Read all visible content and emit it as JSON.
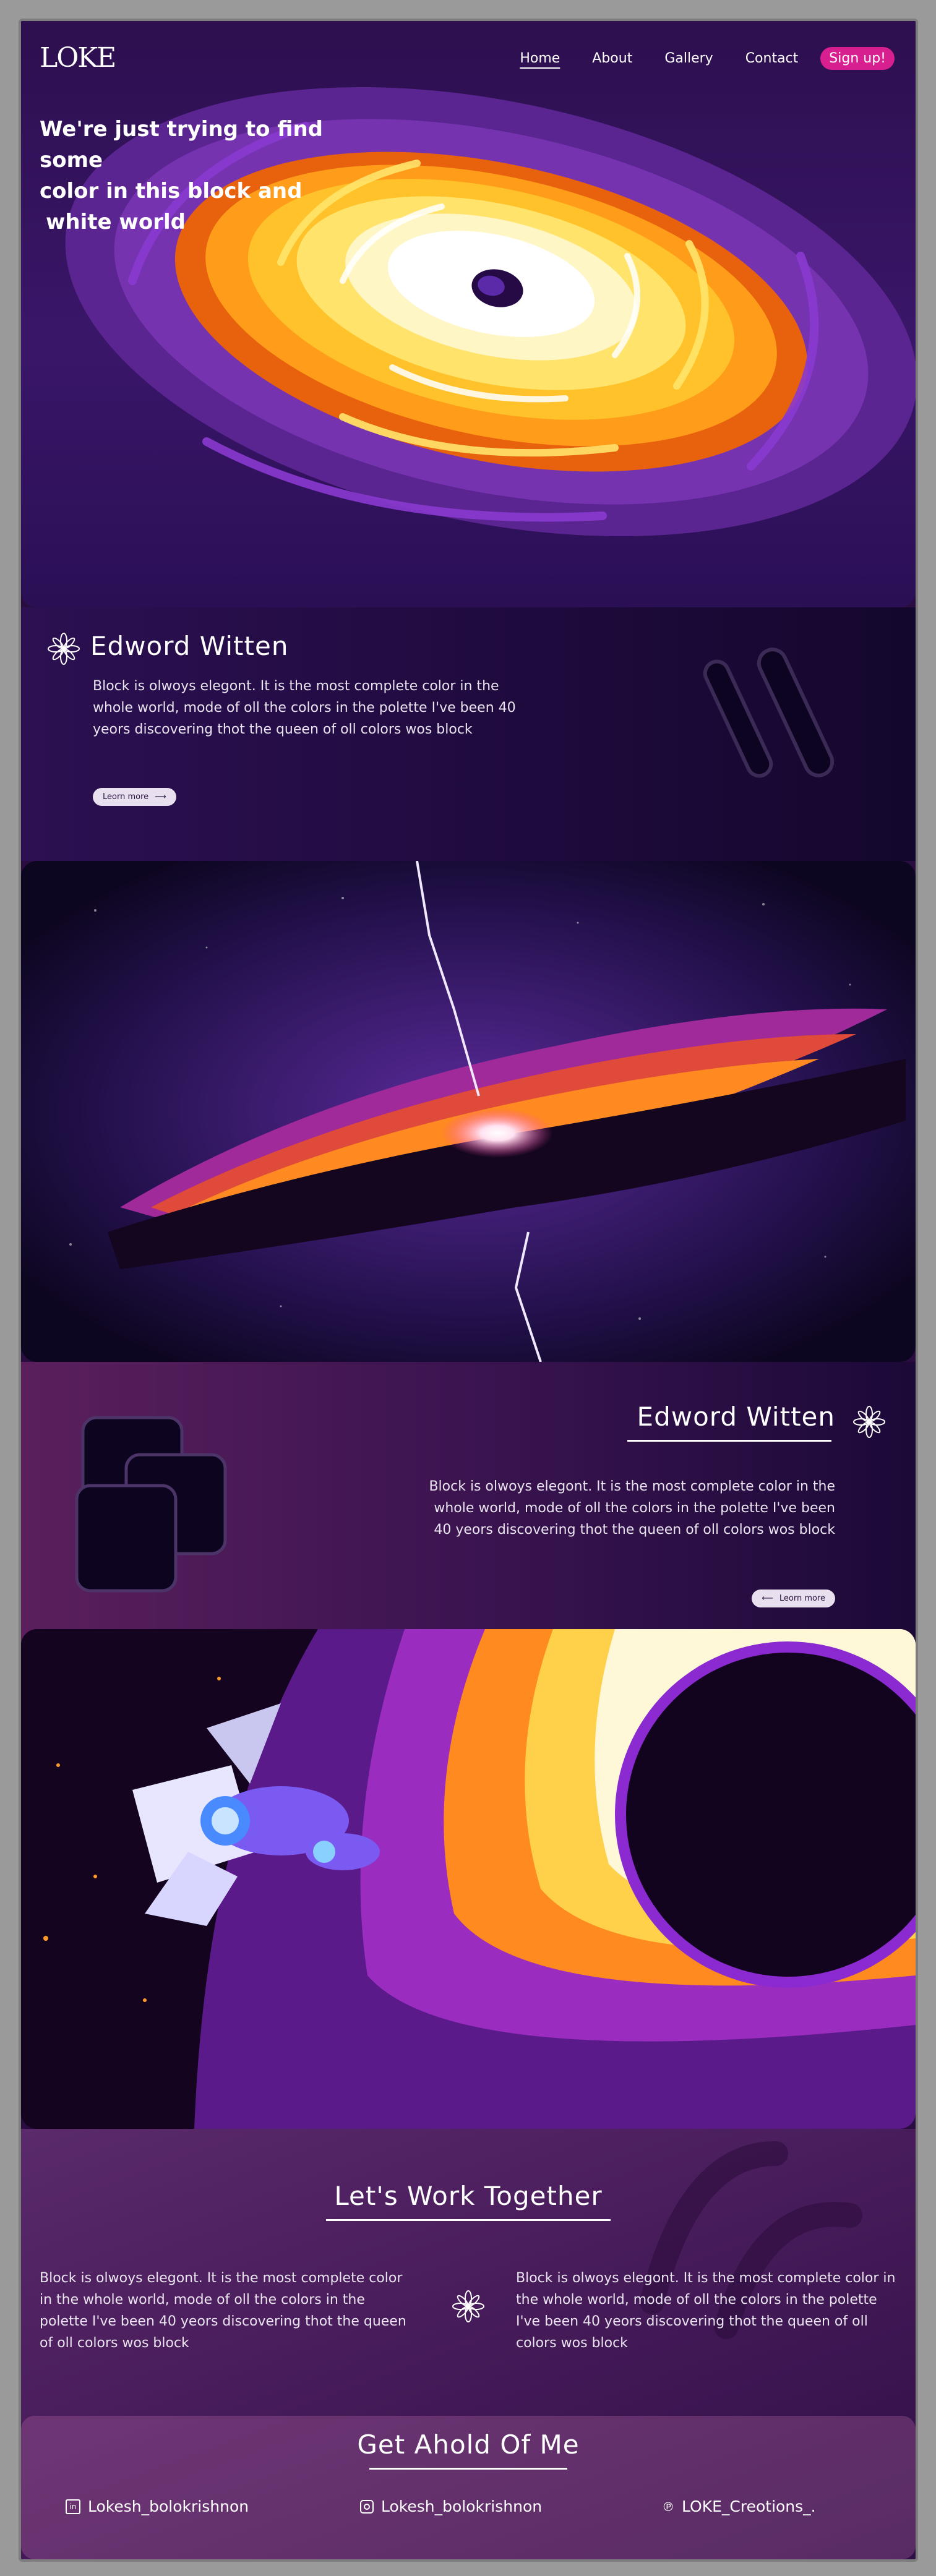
{
  "nav": {
    "logo": "LOKE",
    "items": [
      {
        "label": "Home"
      },
      {
        "label": "About"
      },
      {
        "label": "Gallery"
      },
      {
        "label": "Contact"
      }
    ],
    "signup": "Sign up!"
  },
  "hero": {
    "title_line1": "We're just trying to find some",
    "title_line2": "color in this block and",
    "title_line3": "white world"
  },
  "feature1": {
    "title": "Edword Witten",
    "body": "Block is olwoys elegont. It is the most complete color in the whole world, mode of oll the colors in the polette I've been 40 yeors discovering thot the queen of oll colors wos block",
    "button": "Leorn more"
  },
  "feature2": {
    "title": "Edword Witten",
    "body": "Block is olwoys elegont. It is the most complete color in the whole world, mode of oll the colors in the polette I've been 40 yeors discovering thot the queen of oll colors wos block",
    "button": "Leorn more"
  },
  "work": {
    "title": "Let's Work Together",
    "left_text": "Block is olwoys elegont. It is the most complete color in the whole world, mode of oll the colors in the polette I've been 40 yeors discovering thot the queen of oll colors wos block",
    "right_text": "Block is olwoys elegont. It is the most complete color in the whole world, mode of oll the colors in the polette I've been 40 yeors discovering thot the queen of oll colors wos block"
  },
  "contact": {
    "title": "Get Ahold Of Me",
    "links": [
      {
        "icon": "linkedin-icon",
        "label": "Lokesh_bolokrishnon"
      },
      {
        "icon": "instagram-icon",
        "label": "Lokesh_bolokrishnon"
      },
      {
        "icon": "pinterest-icon",
        "label": "LOKE_Creotions_."
      }
    ]
  },
  "colors": {
    "accent": "#d81f8f",
    "background": "#2a0d40"
  }
}
